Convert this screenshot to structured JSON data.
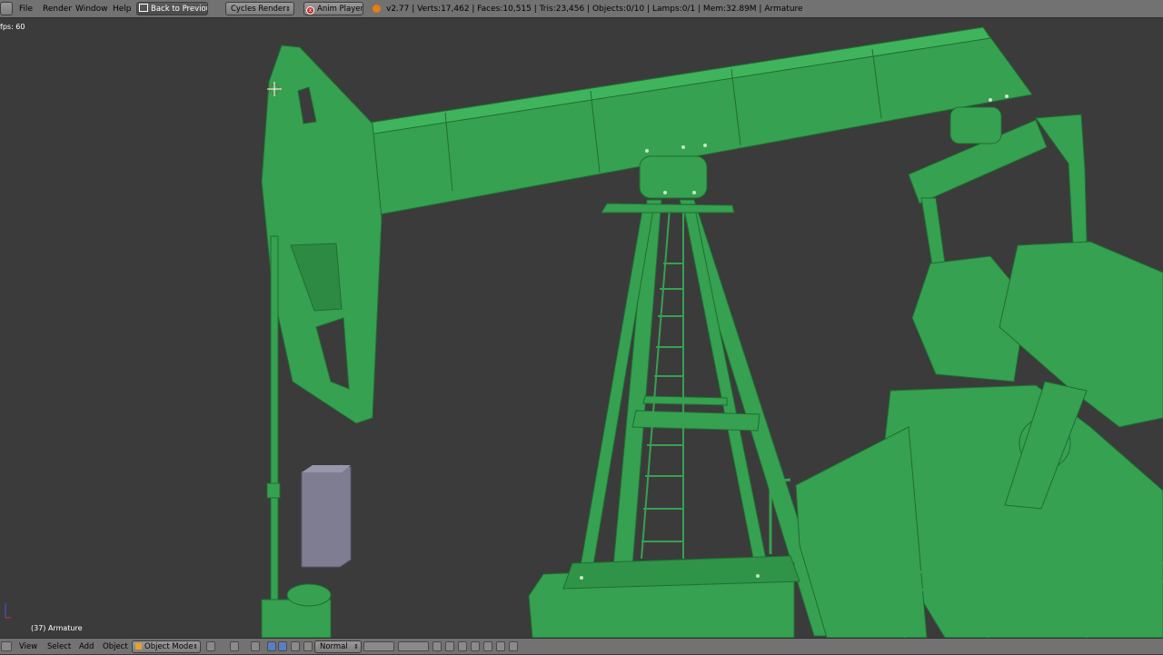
{
  "menu": {
    "file": "File",
    "render": "Render",
    "window": "Window",
    "help": "Help",
    "back_to_previous": "Back to Previous",
    "render_engine": "Cycles Render",
    "anim_player": "Anim Player",
    "stats": "v2.77 | Verts:17,462 | Faces:10,515 | Tris:23,456 | Objects:0/10 | Lamps:0/1 | Mem:32.89M | Armature"
  },
  "viewport": {
    "fps": "fps: 60",
    "object_label": "(37) Armature",
    "model_color": "#36a150",
    "background_color": "#3b3b3b"
  },
  "bottom": {
    "view": "View",
    "select": "Select",
    "add": "Add",
    "object": "Object",
    "mode": "Object Mode",
    "pivot": "Normal"
  }
}
